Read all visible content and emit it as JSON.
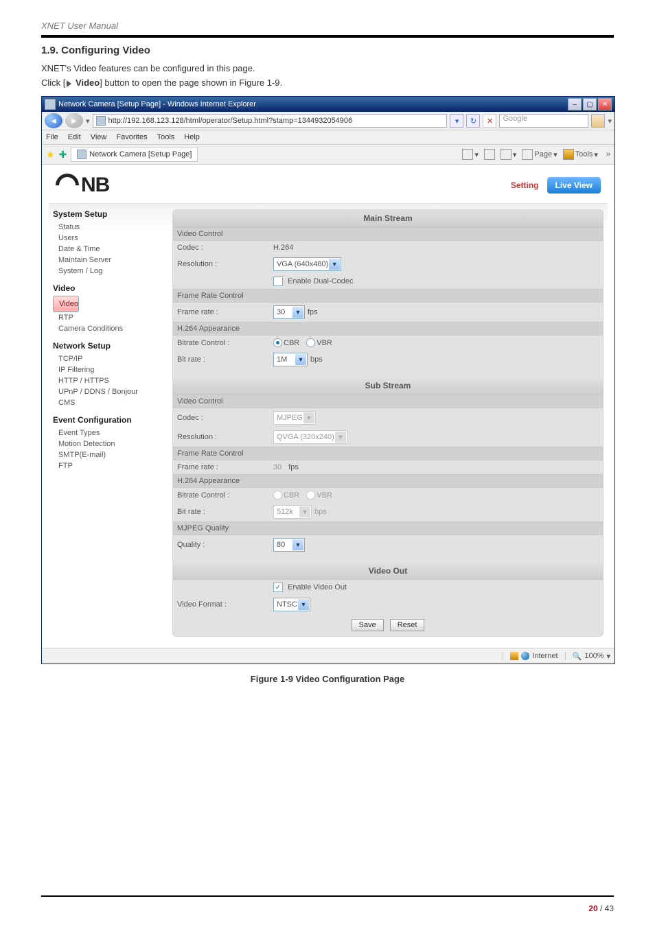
{
  "doc": {
    "running_title": "XNET User Manual",
    "section_heading": "1.9. Configuring Video",
    "intro_line": "XNET's Video features can be configured in this page.",
    "click_prefix": "Click [",
    "click_label": "Video",
    "click_suffix": "] button to open the page shown in Figure 1-9.",
    "figure_caption": "Figure 1-9 Video Configuration Page",
    "page_current": "20",
    "page_sep": " / ",
    "page_total": "43"
  },
  "ie": {
    "window_title": "Network Camera [Setup Page] - Windows Internet Explorer",
    "url": "http://192.168.123.128/html/operator/Setup.html?stamp=1344932054906",
    "search_placeholder": "Google",
    "menus": {
      "file": "File",
      "edit": "Edit",
      "view": "View",
      "favorites": "Favorites",
      "tools": "Tools",
      "help": "Help"
    },
    "tab_label": "Network Camera [Setup Page]",
    "toolbar": {
      "page": "Page",
      "tools": "Tools"
    },
    "status": {
      "zone": "Internet",
      "zoom": "100%"
    }
  },
  "cnb": {
    "top": {
      "setting": "Setting",
      "live_view": "Live View"
    },
    "sidebar": {
      "system_setup": "System Setup",
      "status": "Status",
      "users": "Users",
      "date_time": "Date & Time",
      "maintain": "Maintain Server",
      "syslog": "System / Log",
      "video_hdr": "Video",
      "video": "Video",
      "rtp": "RTP",
      "camera_cond": "Camera Conditions",
      "network_setup": "Network Setup",
      "tcpip": "TCP/IP",
      "ipfilter": "IP Filtering",
      "http": "HTTP / HTTPS",
      "upnp": "UPnP / DDNS / Bonjour",
      "cms": "CMS",
      "event_conf": "Event Configuration",
      "event_types": "Event Types",
      "motion": "Motion Detection",
      "smtp": "SMTP(E-mail)",
      "ftp": "FTP"
    },
    "main": {
      "main_stream": "Main Stream",
      "sub_stream": "Sub Stream",
      "video_out": "Video Out",
      "labels": {
        "video_control": "Video Control",
        "codec": "Codec :",
        "resolution": "Resolution :",
        "enable_dual": "Enable Dual-Codec",
        "frame_rate_control": "Frame Rate Control",
        "frame_rate": "Frame rate :",
        "h264_app": "H.264 Appearance",
        "bitrate_control": "Bitrate Control :",
        "bitrate": "Bit rate :",
        "mjpeg_quality": "MJPEG Quality",
        "quality": "Quality :",
        "enable_video_out": "Enable Video Out",
        "video_format": "Video Format :",
        "cbr": "CBR",
        "vbr": "VBR",
        "fps": "fps",
        "bps": "bps"
      },
      "values": {
        "main_codec": "H.264",
        "main_res": "VGA (640x480)",
        "main_fps": "30",
        "main_bitrate": "1M",
        "sub_codec": "MJPEG",
        "sub_res": "QVGA (320x240)",
        "sub_fps": "30",
        "sub_bitrate": "512k",
        "quality": "80",
        "video_format": "NTSC"
      },
      "buttons": {
        "save": "Save",
        "reset": "Reset"
      }
    }
  }
}
